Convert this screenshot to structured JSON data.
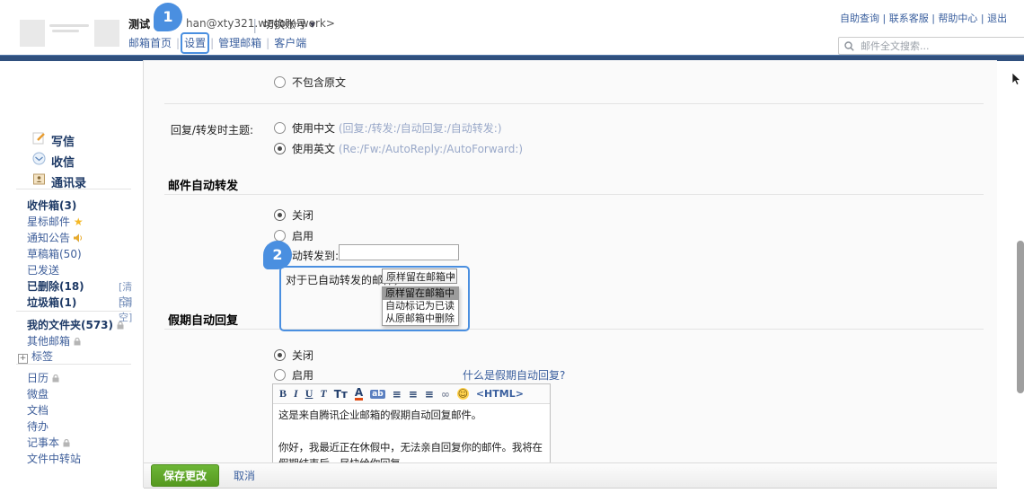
{
  "colors": {
    "annotation_accent": "#4a8fe0",
    "navy_bar": "#30507e",
    "link_blue": "#3a5f9e",
    "save_green": "#55991f"
  },
  "annotations": {
    "step1": "1",
    "step2": "2"
  },
  "header": {
    "account_name": "测试",
    "account_email_visible": "han@xty321.wecom.work>",
    "separator": "|",
    "switch_account": "切换账号",
    "caret": "▼",
    "nav": [
      "邮箱首页",
      "设置",
      "管理邮箱",
      "客户端"
    ],
    "quick_links": "自助查询 | 联系客服 | 帮助中心 | 退出",
    "search_placeholder": "邮件全文搜索..."
  },
  "sidebar": {
    "compose": [
      {
        "label": "写信"
      },
      {
        "label": "收信"
      },
      {
        "label": "通讯录"
      }
    ],
    "folders": [
      {
        "label": "收件箱(3)"
      },
      {
        "label": "星标邮件",
        "suffix": "★"
      },
      {
        "label": "通知公告"
      },
      {
        "label": "草稿箱(50)"
      },
      {
        "label": "已发送"
      },
      {
        "label": "已删除(18)",
        "action": "[清空]"
      },
      {
        "label": "垃圾箱(1)",
        "action": "[清空]"
      }
    ],
    "groups": [
      {
        "label": "我的文件夹(573)"
      },
      {
        "label": "其他邮箱"
      },
      {
        "label": "标签",
        "expander": "+"
      }
    ],
    "apps": [
      {
        "label": "日历"
      },
      {
        "label": "微盘"
      },
      {
        "label": "文档"
      },
      {
        "label": "待办"
      },
      {
        "label": "记事本"
      },
      {
        "label": "文件中转站"
      }
    ]
  },
  "settings": {
    "include_original": {
      "label": "不包含原文"
    },
    "subject_row": {
      "label": "回复/转发时主题:",
      "zh_label": "使用中文",
      "zh_hint": "(回复:/转发:/自动回复:/自动转发:)",
      "en_label": "使用英文",
      "en_hint": "(Re:/Fw:/AutoReply:/AutoForward:)"
    },
    "autoforward": {
      "title": "邮件自动转发",
      "off_label": "关闭",
      "on_label": "启用",
      "forward_to_label": "自动转发到:",
      "forward_to_value": "",
      "handled_label": "对于已自动转发的邮件，",
      "select_value": "原样留在邮箱中",
      "select_chevron": "∨",
      "options": [
        "原样留在邮箱中",
        "自动标记为已读",
        "从原邮箱中删除"
      ]
    },
    "vacation": {
      "title": "假期自动回复",
      "off_label": "关闭",
      "on_label": "启用",
      "help_link": "什么是假期自动回复?",
      "toolbar": [
        {
          "name": "bold",
          "glyph": "B"
        },
        {
          "name": "italic",
          "glyph": "I"
        },
        {
          "name": "underline",
          "glyph": "U"
        },
        {
          "name": "font-family",
          "glyph": "T"
        },
        {
          "name": "font-size",
          "glyph": "Tт"
        },
        {
          "name": "font-color",
          "glyph": "A"
        },
        {
          "name": "highlight",
          "glyph": "ab"
        },
        {
          "name": "align",
          "glyph": "≡"
        },
        {
          "name": "ordered-list",
          "glyph": "≡"
        },
        {
          "name": "indent",
          "glyph": "≡"
        },
        {
          "name": "insert-link",
          "glyph": "∞"
        },
        {
          "name": "emoji",
          "glyph": "☺"
        },
        {
          "name": "html-mode",
          "glyph": "<HTML>"
        }
      ],
      "body_line1": "这是来自腾讯企业邮箱的假期自动回复邮件。",
      "body_line2": "你好，我最近正在休假中，无法亲自回复你的邮件。我将在假期结束后，尽快给你回复。"
    }
  },
  "footer": {
    "save": "保存更改",
    "cancel": "取消"
  }
}
